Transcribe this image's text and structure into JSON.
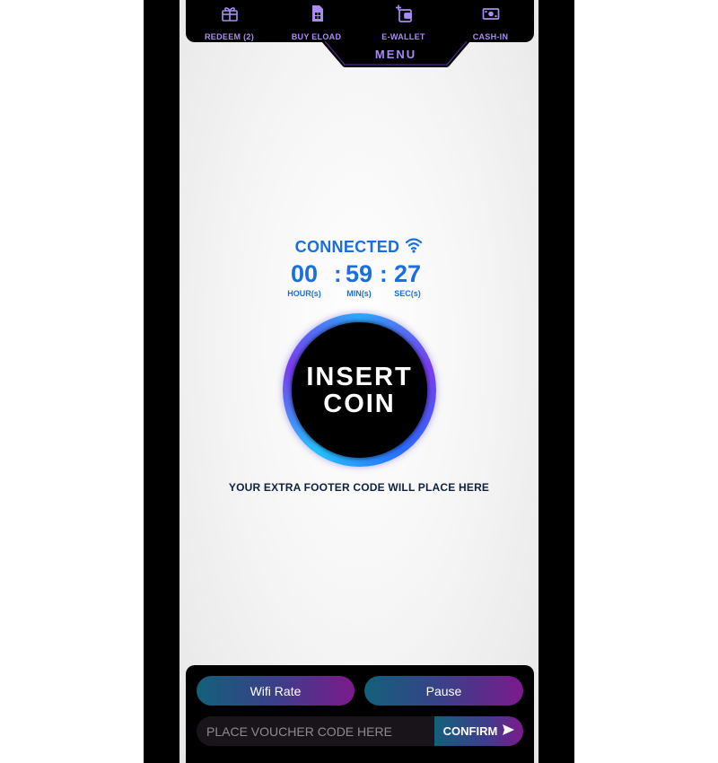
{
  "menu": {
    "items": [
      {
        "label": "REDEEM (2)",
        "icon": "gift-icon"
      },
      {
        "label": "BUY ELOAD",
        "icon": "sim-card-icon"
      },
      {
        "label": "E-WALLET",
        "icon": "wallet-icon"
      },
      {
        "label": "CASH-IN",
        "icon": "banknote-icon"
      }
    ],
    "tab_label": "MENU",
    "accent_color": "#a88cf2"
  },
  "status": {
    "label": "CONNECTED",
    "icon": "wifi-icon",
    "color": "#1a6fe0"
  },
  "timer": {
    "hours": "00",
    "minutes": "59",
    "seconds": "27",
    "hours_unit": "HOUR(s)",
    "minutes_unit": "MIN(s)",
    "seconds_unit": "SEC(s)",
    "separator": ":"
  },
  "coin_button": {
    "line1": "INSERT",
    "line2": "COIN"
  },
  "footer_text": "YOUR EXTRA FOOTER CODE WILL PLACE HERE",
  "controls": {
    "wifi_rate_label": "Wifi Rate",
    "pause_label": "Pause",
    "voucher_placeholder": "PLACE VOUCHER CODE HERE",
    "confirm_label": "CONFIRM",
    "confirm_icon": "send-icon"
  }
}
